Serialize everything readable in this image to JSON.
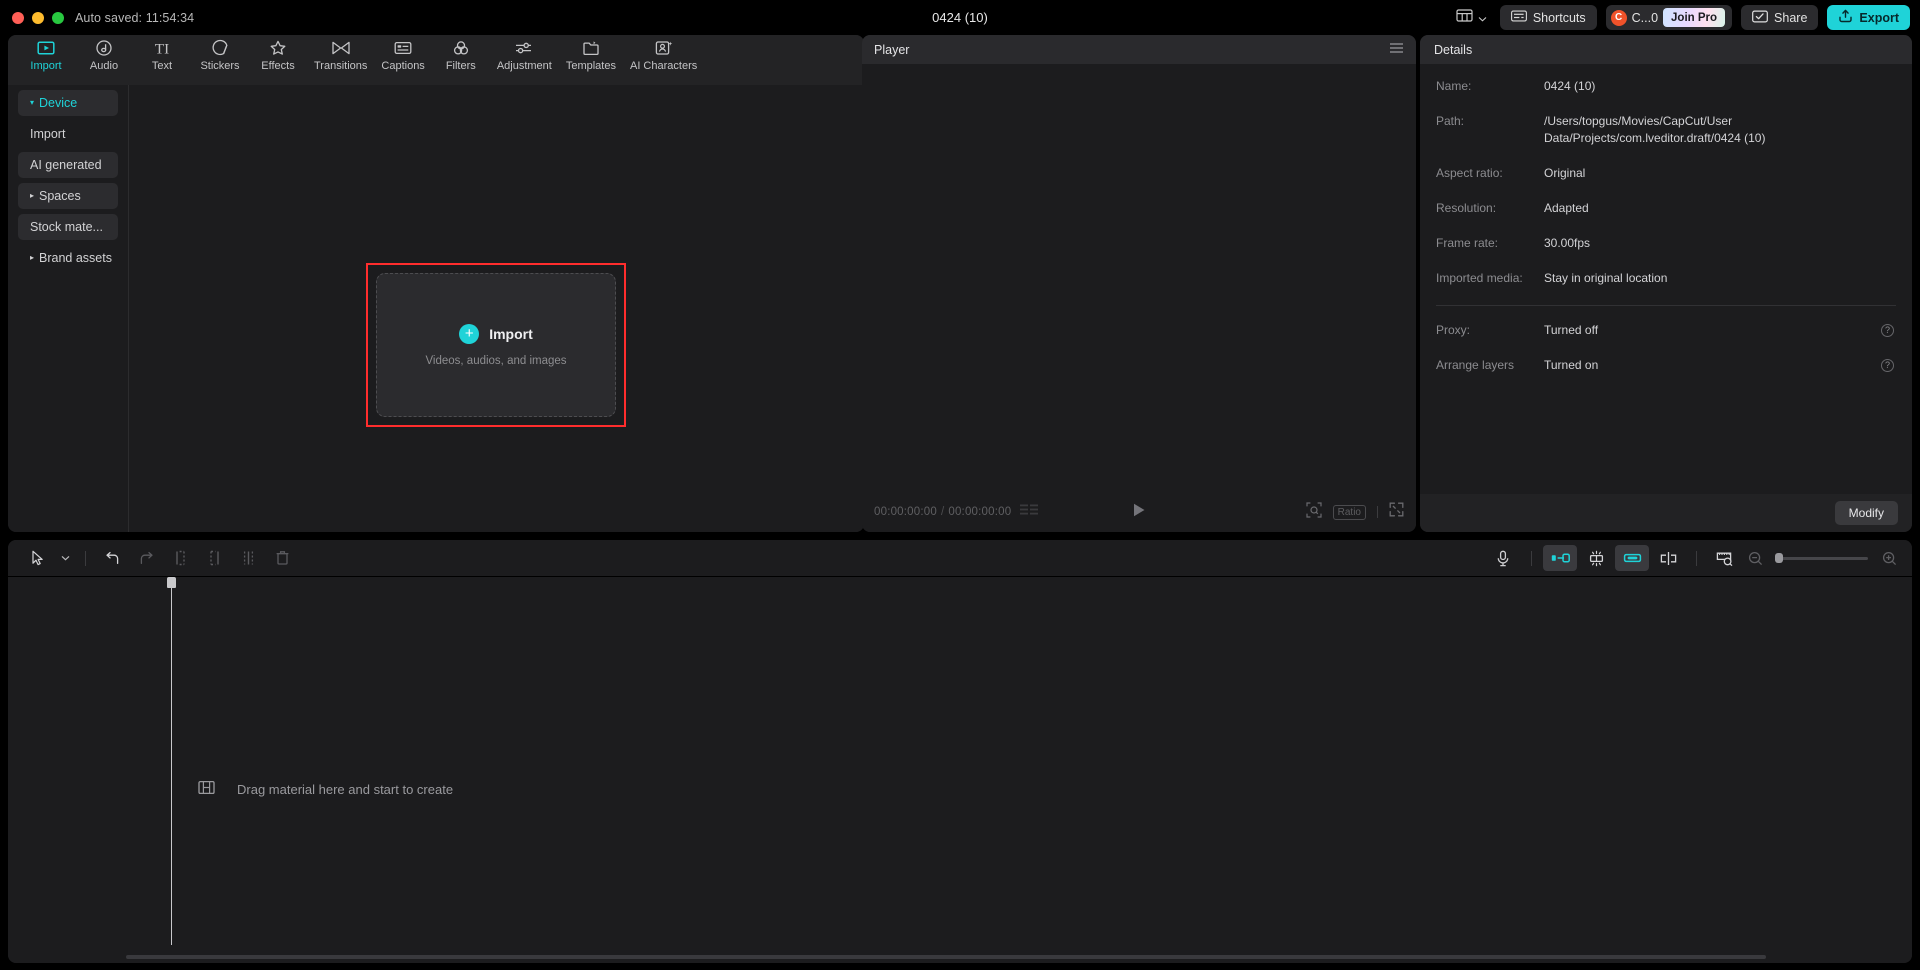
{
  "titlebar": {
    "autosave": "Auto saved: 11:54:34",
    "project_title": "0424 (10)",
    "layout_icon": "layout-panels-icon",
    "shortcuts_label": "Shortcuts",
    "shortcuts_icon": "keyboard-icon",
    "account_initial": "C",
    "account_label": "C...0",
    "join_pro_label": "Join Pro",
    "share_label": "Share",
    "share_icon": "share-screen-icon",
    "export_label": "Export",
    "export_icon": "upload-box-icon",
    "accent_export": "#1fd3d8",
    "traffic": [
      "close",
      "minimize",
      "maximize"
    ]
  },
  "nav": {
    "items": [
      {
        "label": "Import",
        "icon": "import-frame-icon",
        "active": true
      },
      {
        "label": "Audio",
        "icon": "music-note-circle-icon",
        "active": false
      },
      {
        "label": "Text",
        "icon": "text-ti-icon",
        "active": false
      },
      {
        "label": "Stickers",
        "icon": "sticker-circle-icon",
        "active": false
      },
      {
        "label": "Effects",
        "icon": "sparkle-star-icon",
        "active": false
      },
      {
        "label": "Transitions",
        "icon": "bowtie-transition-icon",
        "active": false
      },
      {
        "label": "Captions",
        "icon": "caption-box-icon",
        "active": false
      },
      {
        "label": "Filters",
        "icon": "three-circles-filter-icon",
        "active": false
      },
      {
        "label": "Adjustment",
        "icon": "sliders-icon",
        "active": false
      },
      {
        "label": "Templates",
        "icon": "template-folder-icon",
        "active": false
      },
      {
        "label": "AI Characters",
        "icon": "ai-person-icon",
        "active": false
      }
    ],
    "active_color": "#1fd3d8"
  },
  "library_sidebar": {
    "items": [
      {
        "label": "Device",
        "style": "section",
        "caret": "▾",
        "active": true
      },
      {
        "label": "Import",
        "style": "plain",
        "caret": "",
        "active": false
      },
      {
        "label": "AI generated",
        "style": "section",
        "caret": "",
        "active": false
      },
      {
        "label": "Spaces",
        "style": "section",
        "caret": "▸",
        "active": false
      },
      {
        "label": "Stock mate...",
        "style": "section",
        "caret": "",
        "active": false
      },
      {
        "label": "Brand assets",
        "style": "plain",
        "caret": "▸",
        "active": false
      }
    ]
  },
  "import_zone": {
    "button_label": "Import",
    "plus_icon": "plus-circle-icon",
    "subtitle": "Videos, audios, and images",
    "highlight_color": "#ff2d2d"
  },
  "player": {
    "title": "Player",
    "menu_icon": "hamburger-menu-icon",
    "current_time": "00:00:00:00",
    "total_time": "00:00:00:00",
    "separator": "/",
    "play_icon": "play-triangle-icon",
    "quality_icon": "magnify-frame-icon",
    "ratio_label": "Ratio",
    "fullscreen_icon": "expand-arrows-icon",
    "bars_icon": "quality-bars-icon"
  },
  "details": {
    "title": "Details",
    "rows": [
      {
        "key": "Name:",
        "value": "0424 (10)",
        "help": false
      },
      {
        "key": "Path:",
        "value": "/Users/topgus/Movies/CapCut/User Data/Projects/com.lveditor.draft/0424 (10)",
        "help": false
      },
      {
        "key": "Aspect ratio:",
        "value": "Original",
        "help": false
      },
      {
        "key": "Resolution:",
        "value": "Adapted",
        "help": false
      },
      {
        "key": "Frame rate:",
        "value": "30.00fps",
        "help": false
      },
      {
        "key": "Imported media:",
        "value": "Stay in original location",
        "help": false
      }
    ],
    "rows_after_sep": [
      {
        "key": "Proxy:",
        "value": "Turned off",
        "help": true
      },
      {
        "key": "Arrange layers",
        "value": "Turned on",
        "help": true
      }
    ],
    "help_icon": "question-circle-icon",
    "modify_label": "Modify"
  },
  "timeline": {
    "tools_left": [
      {
        "icon": "select-arrow-icon",
        "state": "on"
      },
      {
        "icon": "chevron-down-icon",
        "state": "on"
      },
      {
        "icon": "undo-arrow-icon",
        "state": "on"
      },
      {
        "icon": "redo-arrow-icon",
        "state": "dim"
      },
      {
        "icon": "split-left-icon",
        "state": "dim"
      },
      {
        "icon": "split-right-icon",
        "state": "dim"
      },
      {
        "icon": "split-center-icon",
        "state": "dim"
      },
      {
        "icon": "delete-trash-icon",
        "state": "dim"
      }
    ],
    "tools_right": [
      {
        "icon": "microphone-icon",
        "state": "on",
        "active": false
      },
      {
        "icon": "auto-caption-icon",
        "state": "on",
        "active": true
      },
      {
        "icon": "snap-magnet-icon",
        "state": "on",
        "active": false
      },
      {
        "icon": "link-clip-icon",
        "state": "on",
        "active": true
      },
      {
        "icon": "mirror-split-icon",
        "state": "on",
        "active": false
      },
      {
        "icon": "timeline-preview-icon",
        "state": "on",
        "active": false
      }
    ],
    "zoom_out_icon": "zoom-out-icon",
    "zoom_in_icon": "zoom-in-icon",
    "zoom_value": 0,
    "empty_message": "Drag material here and start to create",
    "empty_icon": "filmstrip-icon"
  }
}
